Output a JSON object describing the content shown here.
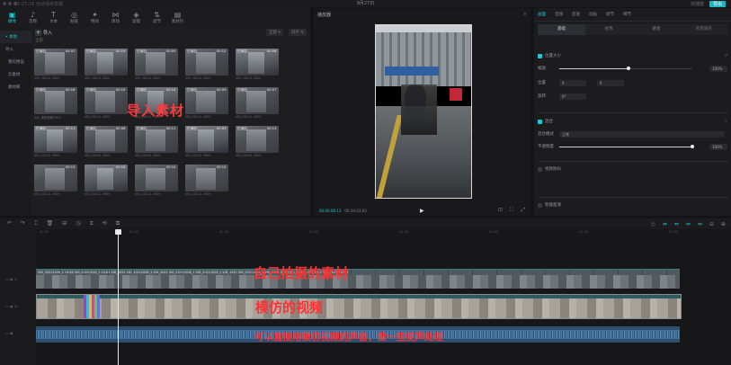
{
  "window": {
    "left_text": "22:27:16 自动保存草稿",
    "title": "9月27日",
    "right_items": [
      "快捷键",
      "导出"
    ]
  },
  "toolbar": {
    "items": [
      {
        "label": "媒体",
        "glyph": "▣",
        "active": true
      },
      {
        "label": "音频",
        "glyph": "♪",
        "active": false
      },
      {
        "label": "文本",
        "glyph": "T",
        "active": false
      },
      {
        "label": "贴纸",
        "glyph": "◎",
        "active": false
      },
      {
        "label": "特效",
        "glyph": "✦",
        "active": false
      },
      {
        "label": "转场",
        "glyph": "⋈",
        "active": false
      },
      {
        "label": "滤镜",
        "glyph": "◈",
        "active": false
      },
      {
        "label": "调节",
        "glyph": "⇅",
        "active": false
      },
      {
        "label": "素材包",
        "glyph": "▤",
        "active": false
      }
    ]
  },
  "sidebar": {
    "items": [
      {
        "label": "• 本地",
        "active": true
      },
      {
        "label": "导入",
        "active": false
      },
      {
        "label": "· 我的预设",
        "active": false
      },
      {
        "label": "· 云素材",
        "active": false
      },
      {
        "label": "· 素材库",
        "active": false
      }
    ]
  },
  "media": {
    "import_label": "导入",
    "filters": [
      "全部 ▾",
      "排序 ⇅"
    ],
    "section_label": "全部",
    "overlay": "导入素材",
    "thumbs": [
      {
        "badge": "已添加",
        "dur": "04:02",
        "cap": "VID_20211..MOV"
      },
      {
        "badge": "已添加",
        "dur": "00:19",
        "cap": "VID_20211..MOV"
      },
      {
        "badge": "已添加",
        "dur": "00:05",
        "cap": "VID_20211..MOV"
      },
      {
        "badge": "已添加",
        "dur": "00:12",
        "cap": "VID_20211..MOV"
      },
      {
        "badge": "已添加",
        "dur": "00:08",
        "cap": "VID_20211..MOV"
      },
      {
        "badge": "已添加",
        "dur": "00:16",
        "cap": "4/6..录制视频.MOV"
      },
      {
        "badge": "已添加",
        "dur": "00:10",
        "cap": "VID_20211..MOV"
      },
      {
        "badge": "已添加",
        "dur": "00:14",
        "cap": "VID_20211..MOV"
      },
      {
        "badge": "已添加",
        "dur": "00:09",
        "cap": "VID_20211..MOV"
      },
      {
        "badge": "已添加",
        "dur": "00:07",
        "cap": "VID_20211..MOV"
      },
      {
        "badge": "已添加",
        "dur": "00:11",
        "cap": "VID_20211..MOV"
      },
      {
        "badge": "已添加",
        "dur": "00:06",
        "cap": "VID_20211..MOV"
      },
      {
        "badge": "已添加",
        "dur": "00:11",
        "cap": "VID_20211..MOV"
      },
      {
        "badge": "已添加",
        "dur": "00:05",
        "cap": "VID_20211..MOV"
      },
      {
        "badge": "已添加",
        "dur": "00:13",
        "cap": "VID_20211..MOV"
      },
      {
        "badge": "",
        "dur": "00:13",
        "cap": "VID_20211..MOV"
      },
      {
        "badge": "",
        "dur": "00:16",
        "cap": "VID_20211..MOV"
      },
      {
        "badge": "",
        "dur": "00:10",
        "cap": "VID_20211..MOV"
      },
      {
        "badge": "",
        "dur": "00:15",
        "cap": "VID_20211..MOV"
      }
    ]
  },
  "player": {
    "title": "播放器",
    "current_time": "00:00:08:11",
    "total_time": "00:14:03:03",
    "play_glyph": "▶",
    "right_glyphs": [
      "⊡",
      "⛶",
      "⤢"
    ]
  },
  "props": {
    "tabs": [
      "画面",
      "音频",
      "变速",
      "动画",
      "调节",
      "细节"
    ],
    "subtabs": [
      "基础",
      "抠像",
      "蒙版",
      "背景填充"
    ],
    "scale_label": "位置大小",
    "scale_row": "缩放",
    "scale_value": "100%",
    "pos_label": "位置",
    "pos_x": "0",
    "pos_y": "0",
    "rotate_label": "旋转",
    "rotate_value": "0°",
    "blend_label": "混合",
    "mix_mode_label": "混合模式",
    "mix_mode_value": "正常",
    "opacity_label": "不透明度",
    "opacity_value": "100%",
    "stabilize_label": "视频防抖",
    "ai_label": "智能超清",
    "scale_fill": 0.52,
    "opacity_fill": 1.0
  },
  "timeline": {
    "toolbar_left": [
      "↶",
      "↷",
      "⌶",
      "🗑",
      "⊟",
      "◷",
      "⧖",
      "⟲",
      "⧉"
    ],
    "toolbar_right": [
      "◇",
      "⇔",
      "⇔",
      "⇔",
      "⇔",
      "⊖",
      "⊕"
    ],
    "ruler_ticks": [
      "00:00",
      "00:20",
      "00:40",
      "01:00",
      "01:20",
      "01:40",
      "02:00",
      "02:20"
    ],
    "clip_label": "VID_20211026_1 13:56 VID_20211026_1 14:02 VID_2021 VID_20211026_1 VID_2021 VID_20211026_1 VID_20211026_1 VID_2021 VID_20211026_1 VID_2021 VID_20211026_1 VID_2021 VID_20211026_1",
    "annotation_clip": "自己拍摄的素材",
    "annotation_main": "模仿的视频",
    "annotation_audio": "可以直接用模仿视频的声音，做一些变声处理"
  }
}
